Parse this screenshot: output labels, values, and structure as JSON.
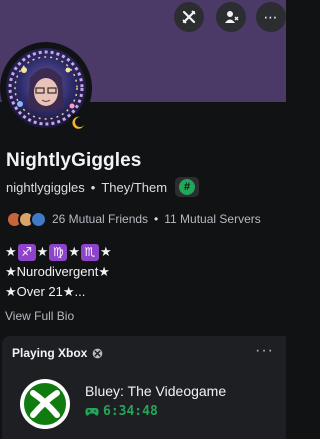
{
  "colors": {
    "banner": "#4b3a67",
    "background": "#111214",
    "online_green": "#23a55a",
    "zodiac_purple": "#8e44c9",
    "xbox_green": "#107c10"
  },
  "toolbar": {
    "buttons": [
      {
        "icon": "swords-crossed-icon"
      },
      {
        "icon": "user-add-icon"
      },
      {
        "icon": "more-options-icon",
        "label": "⋯"
      }
    ]
  },
  "profile": {
    "display_name": "NightlyGiggles",
    "username": "nightlygiggles",
    "separator": "•",
    "pronouns": "They/Them",
    "badge_icon": "hash-badge-icon",
    "badge_text": "#"
  },
  "mutuals": {
    "friends": "26 Mutual Friends",
    "separator": "•",
    "servers": "11 Mutual Servers"
  },
  "bio": {
    "line1": {
      "stars_open": "★",
      "sign1": "♐",
      "star_mid1": "★",
      "sign2": "♍",
      "star_mid2": "★",
      "sign3": "♏",
      "stars_close": "★"
    },
    "line2": "★Nurodivergent★",
    "line3": "★Over 21★..."
  },
  "view_full_bio": "View Full Bio",
  "activity": {
    "header": "Playing Xbox",
    "more": "···",
    "game_title": "Bluey: The Videogame",
    "elapsed": "6:34:48"
  }
}
